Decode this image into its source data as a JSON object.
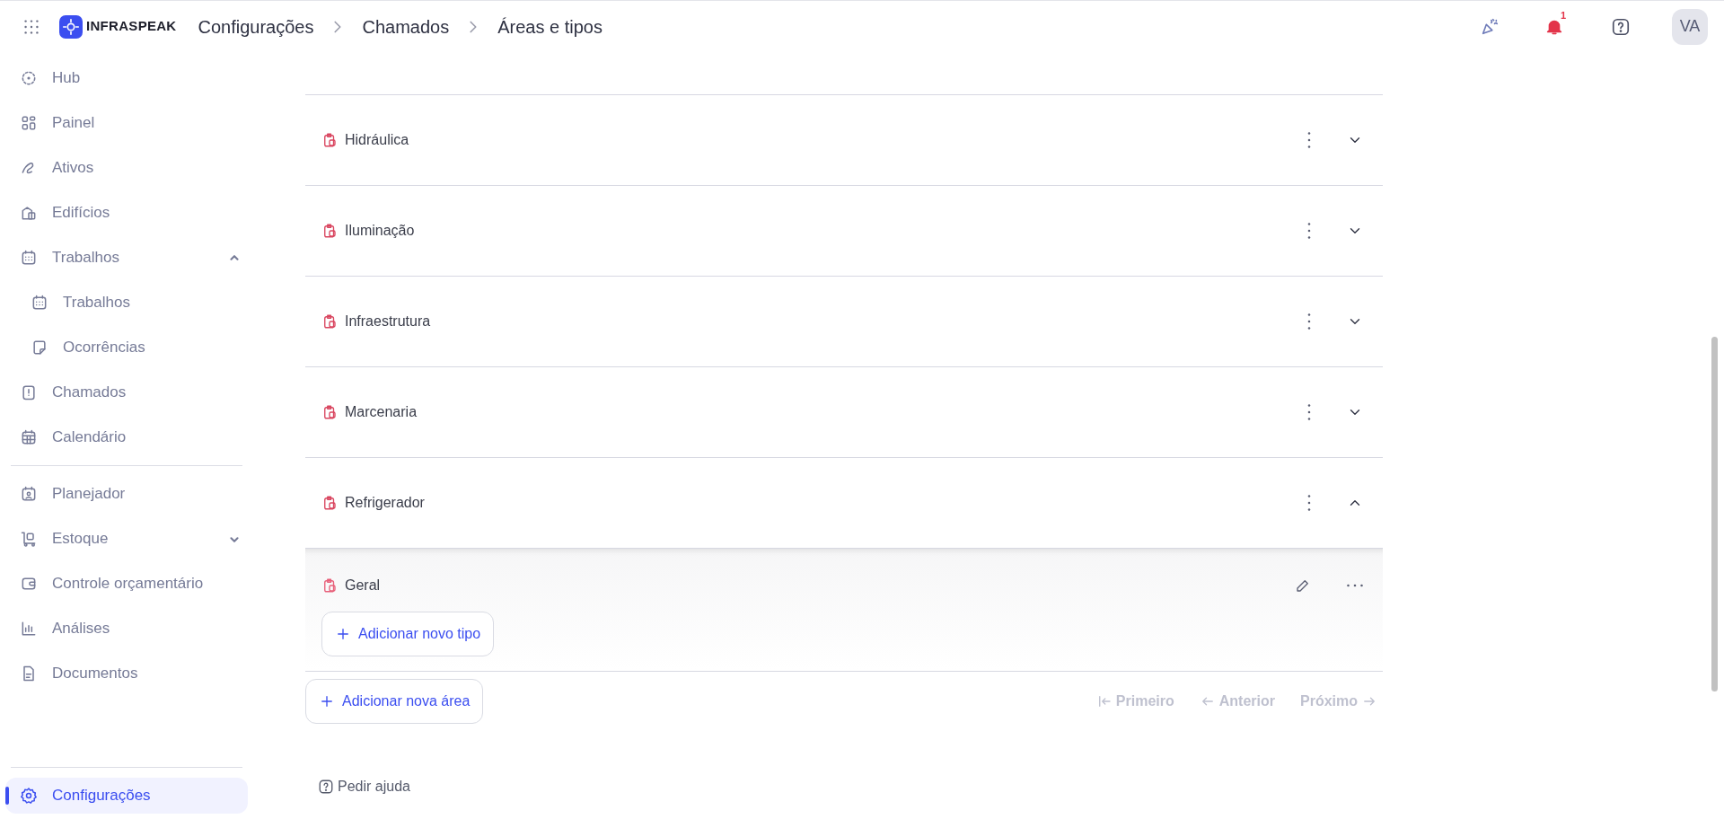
{
  "topbar": {
    "logo": "INFRASPEAK",
    "breadcrumbs": [
      "Configurações",
      "Chamados",
      "Áreas e tipos"
    ],
    "notification_count": "1",
    "avatar": "VA"
  },
  "sidebar": {
    "groups": [
      {
        "items": [
          {
            "label": "Hub",
            "selected": false
          },
          {
            "label": "Painel",
            "selected": false
          },
          {
            "label": "Ativos",
            "selected": false
          },
          {
            "label": "Edifícios",
            "selected": false
          },
          {
            "label": "Trabalhos",
            "selected": false,
            "expanded": true,
            "children": [
              {
                "label": "Trabalhos",
                "selected": false
              },
              {
                "label": "Ocorrências",
                "selected": false
              }
            ]
          },
          {
            "label": "Chamados",
            "selected": false
          },
          {
            "label": "Calendário",
            "selected": false
          }
        ]
      },
      {
        "items": [
          {
            "label": "Planejador",
            "selected": false
          },
          {
            "label": "Estoque",
            "selected": false,
            "expanded": false
          },
          {
            "label": "Controle orçamentário",
            "selected": false
          },
          {
            "label": "Análises",
            "selected": false
          },
          {
            "label": "Documentos",
            "selected": false
          }
        ]
      }
    ],
    "footer_items": [
      {
        "label": "Configurações",
        "selected": true
      }
    ]
  },
  "areas": [
    {
      "name": "Hidráulica",
      "expanded": false
    },
    {
      "name": "Iluminação",
      "expanded": false
    },
    {
      "name": "Infraestrutura",
      "expanded": false
    },
    {
      "name": "Marcenaria",
      "expanded": false
    },
    {
      "name": "Refrigerador",
      "expanded": true,
      "types": [
        "Geral"
      ],
      "add_type_button": "Adicionar novo tipo"
    }
  ],
  "add_area_button": "Adicionar nova área",
  "pagination": [
    {
      "label": "Primeiro",
      "kind": "first",
      "disabled": true
    },
    {
      "label": "Anterior",
      "kind": "prev",
      "disabled": true
    },
    {
      "label": "Próximo",
      "kind": "next",
      "disabled": true
    }
  ],
  "help_link": "Pedir ajuda"
}
